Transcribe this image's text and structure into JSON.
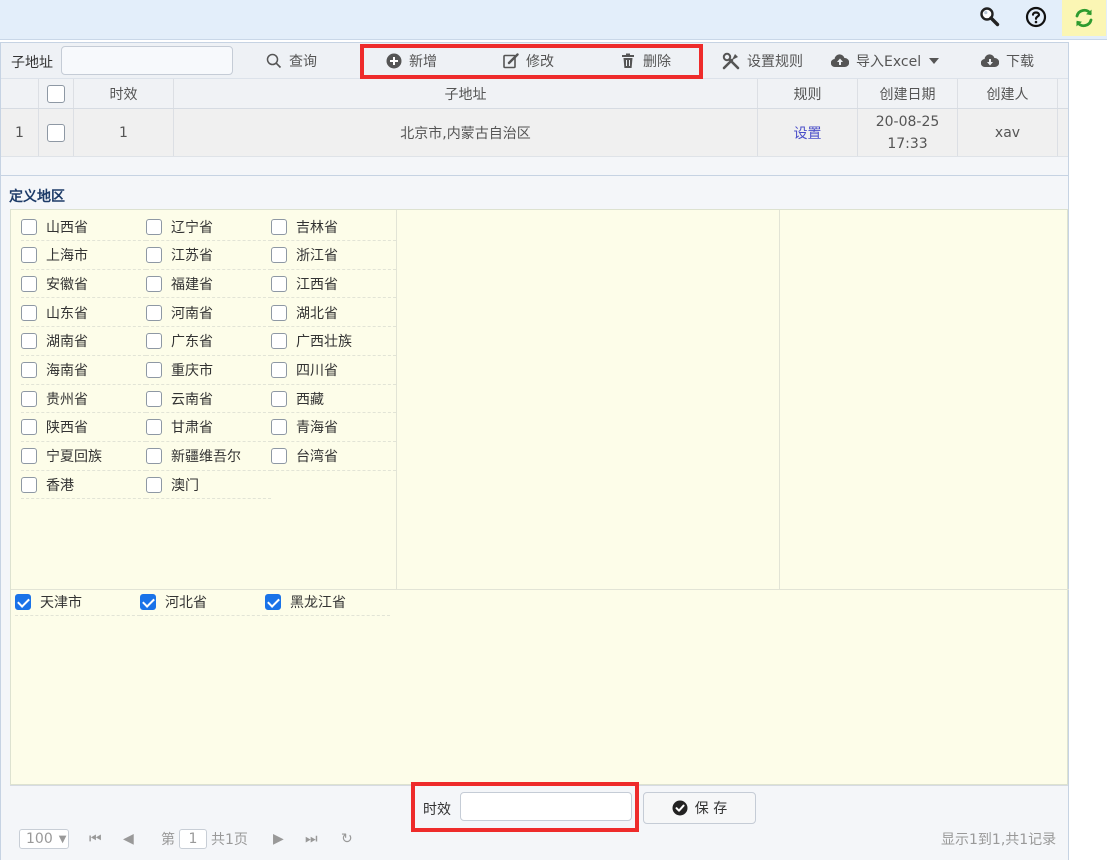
{
  "topbar": {
    "icons": [
      "search-icon",
      "help-icon",
      "refresh-icon"
    ]
  },
  "toolbar": {
    "filter_label": "子地址",
    "filter_value": "",
    "query_label": "查询",
    "add_label": "新增",
    "edit_label": "修改",
    "delete_label": "删除",
    "rules_label": "设置规则",
    "import_label": "导入Excel",
    "download_label": "下载"
  },
  "grid": {
    "columns": [
      "时效",
      "子地址",
      "规则",
      "创建日期",
      "创建人"
    ],
    "rows": [
      {
        "index": "1",
        "timeliness": "1",
        "sub_address": "北京市,内蒙古自治区",
        "rule": "设置",
        "date": "20-08-25",
        "time": "17:33",
        "creator": "xav"
      }
    ]
  },
  "region_section": {
    "title": "定义地区",
    "available": [
      "山西省",
      "辽宁省",
      "吉林省",
      "上海市",
      "江苏省",
      "浙江省",
      "安徽省",
      "福建省",
      "江西省",
      "山东省",
      "河南省",
      "湖北省",
      "湖南省",
      "广东省",
      "广西壮族",
      "海南省",
      "重庆市",
      "四川省",
      "贵州省",
      "云南省",
      "西藏",
      "陕西省",
      "甘肃省",
      "青海省",
      "宁夏回族",
      "新疆维吾尔",
      "台湾省",
      "香港",
      "澳门"
    ],
    "selected": [
      "天津市",
      "河北省",
      "黑龙江省"
    ]
  },
  "footer": {
    "timeliness_label": "时效",
    "timeliness_value": "",
    "save_label": "保 存"
  },
  "pager": {
    "page_size": "100",
    "page_prefix": "第",
    "page_number": "1",
    "page_total": "共1页",
    "summary": "显示1到1,共1记录"
  },
  "colors": {
    "accent": "#1a73e8",
    "highlight": "#ee2b2b",
    "link": "#4a4ec9"
  }
}
